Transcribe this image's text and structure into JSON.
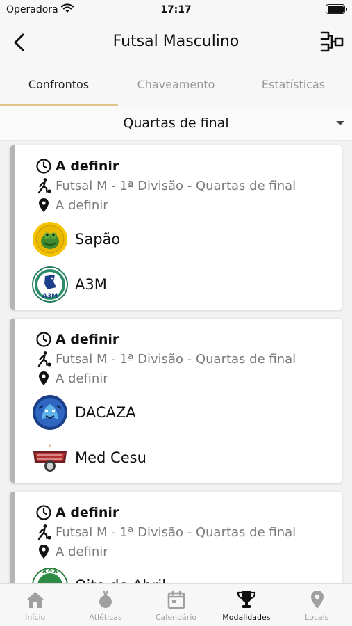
{
  "status_bar": {
    "carrier": "Operadora",
    "time": "17:17"
  },
  "header": {
    "title": "Futsal Masculino"
  },
  "tabs": [
    {
      "label": "Confrontos",
      "active": true
    },
    {
      "label": "Chaveamento",
      "active": false
    },
    {
      "label": "Estatísticas",
      "active": false
    }
  ],
  "phase_select": {
    "value": "Quartas de final"
  },
  "matches": [
    {
      "time": "A definir",
      "competition": "Futsal M - 1ª Divisão - Quartas de final",
      "location": "A definir",
      "team_a": "Sapão",
      "team_b": "A3M"
    },
    {
      "time": "A definir",
      "competition": "Futsal M - 1ª Divisão - Quartas de final",
      "location": "A definir",
      "team_a": "DACAZA",
      "team_b": "Med Cesu"
    },
    {
      "time": "A definir",
      "competition": "Futsal M - 1ª Divisão - Quartas de final",
      "location": "A definir",
      "team_a": "Oito de Abril",
      "team_b": ""
    }
  ],
  "bottom_nav": [
    {
      "label": "Início",
      "icon": "home-icon",
      "active": false
    },
    {
      "label": "Atléticas",
      "icon": "medal-icon",
      "active": false
    },
    {
      "label": "Calendário",
      "icon": "calendar-icon",
      "active": false
    },
    {
      "label": "Modalidades",
      "icon": "trophy-icon",
      "active": true
    },
    {
      "label": "Locais",
      "icon": "location-pin-icon",
      "active": false
    }
  ],
  "colors": {
    "accent": "#e0c58a",
    "card_border": "#b5b5b5",
    "inactive": "#a0a0a0"
  }
}
